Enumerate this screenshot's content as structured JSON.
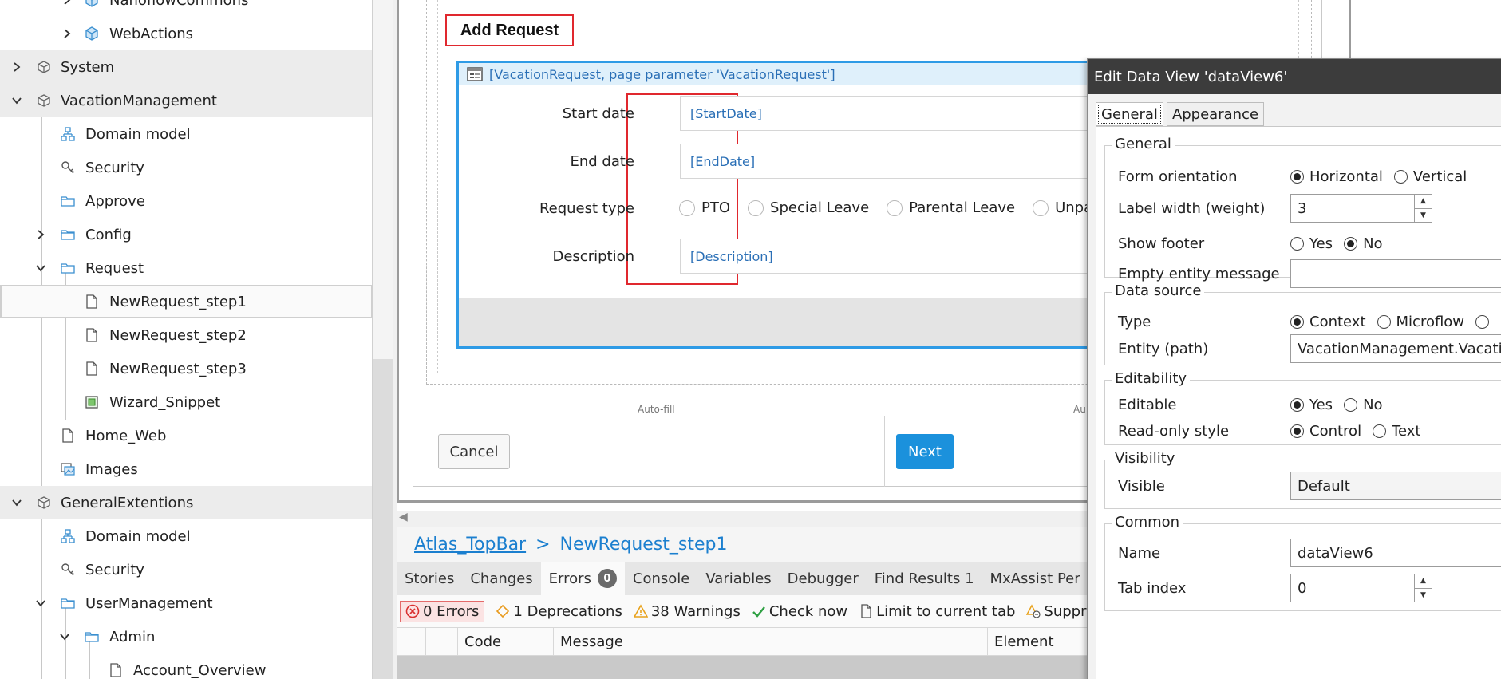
{
  "tree": {
    "items": [
      {
        "label": "NanoflowCommons",
        "icon": "module-cube-icon"
      },
      {
        "label": "WebActions",
        "icon": "module-cube-icon"
      },
      {
        "label": "System",
        "icon": "module-box-icon"
      },
      {
        "label": "VacationManagement",
        "icon": "module-box-icon"
      },
      {
        "label": "Domain model",
        "icon": "domain-model-icon"
      },
      {
        "label": "Security",
        "icon": "key-icon"
      },
      {
        "label": "Approve",
        "icon": "folder-icon"
      },
      {
        "label": "Config",
        "icon": "folder-icon"
      },
      {
        "label": "Request",
        "icon": "folder-icon"
      },
      {
        "label": "NewRequest_step1",
        "icon": "page-icon"
      },
      {
        "label": "NewRequest_step2",
        "icon": "page-icon"
      },
      {
        "label": "NewRequest_step3",
        "icon": "page-icon"
      },
      {
        "label": "Wizard_Snippet",
        "icon": "snippet-icon"
      },
      {
        "label": "Home_Web",
        "icon": "page-icon"
      },
      {
        "label": "Images",
        "icon": "images-icon"
      },
      {
        "label": "GeneralExtentions",
        "icon": "module-box-icon"
      },
      {
        "label": "Domain model",
        "icon": "domain-model-icon"
      },
      {
        "label": "Security",
        "icon": "key-icon"
      },
      {
        "label": "UserManagement",
        "icon": "folder-icon"
      },
      {
        "label": "Admin",
        "icon": "folder-icon"
      },
      {
        "label": "Account_Overview",
        "icon": "page-icon"
      }
    ]
  },
  "editor": {
    "page_title": "Add Request",
    "dataview_header": "[VacationRequest, page parameter 'VacationRequest']",
    "fields": {
      "start_date": {
        "label": "Start date",
        "value": "[StartDate]"
      },
      "end_date": {
        "label": "End date",
        "value": "[EndDate]"
      },
      "request_type": {
        "label": "Request type",
        "options": [
          "PTO",
          "Special Leave",
          "Parental Leave",
          "Unpaid"
        ]
      },
      "description": {
        "label": "Description",
        "value": "[Description]"
      }
    },
    "autofill_left": "Auto-fill",
    "autofill_right": "Au",
    "cancel_label": "Cancel",
    "next_label": "Next"
  },
  "breadcrumb": {
    "parent": "Atlas_TopBar",
    "separator": ">",
    "current": "NewRequest_step1"
  },
  "bottom_panel": {
    "tabs": [
      "Stories",
      "Changes",
      "Errors",
      "Console",
      "Variables",
      "Debugger",
      "Find Results 1",
      "MxAssist Per"
    ],
    "errors_badge": "0",
    "toolbar": {
      "errors": "0 Errors",
      "deprecations": "1 Deprecations",
      "warnings": "38 Warnings",
      "check_now": "Check now",
      "limit": "Limit to current tab",
      "suppress": "Suppres"
    },
    "columns": [
      "Code",
      "Message",
      "Element"
    ]
  },
  "dialog": {
    "title": "Edit Data View 'dataView6'",
    "tabs": [
      "General",
      "Appearance"
    ],
    "groups": {
      "general": {
        "title": "General",
        "form_orientation": {
          "label": "Form orientation",
          "options": [
            "Horizontal",
            "Vertical"
          ],
          "selected": "Horizontal"
        },
        "label_width": {
          "label": "Label width (weight)",
          "value": "3"
        },
        "show_footer": {
          "label": "Show footer",
          "options": [
            "Yes",
            "No"
          ],
          "selected": "No"
        },
        "empty_entity": {
          "label": "Empty entity message",
          "value": ""
        }
      },
      "data_source": {
        "title": "Data source",
        "type": {
          "label": "Type",
          "options": [
            "Context",
            "Microflow"
          ],
          "selected": "Context"
        },
        "entity": {
          "label": "Entity (path)",
          "value": "VacationManagement.VacationRequest"
        }
      },
      "editability": {
        "title": "Editability",
        "editable": {
          "label": "Editable",
          "options": [
            "Yes",
            "No"
          ],
          "selected": "Yes"
        },
        "readonly_style": {
          "label": "Read-only style",
          "options": [
            "Control",
            "Text"
          ],
          "selected": "Control"
        }
      },
      "visibility": {
        "title": "Visibility",
        "visible": {
          "label": "Visible",
          "value": "Default"
        }
      },
      "common": {
        "title": "Common",
        "name": {
          "label": "Name",
          "value": "dataView6"
        },
        "tab_index": {
          "label": "Tab index",
          "value": "0"
        }
      }
    }
  },
  "colors": {
    "accent_blue": "#1b91dc",
    "highlight_red": "#e0282e",
    "dataview_border": "#2e9be6",
    "link_blue": "#1b7fcf"
  }
}
